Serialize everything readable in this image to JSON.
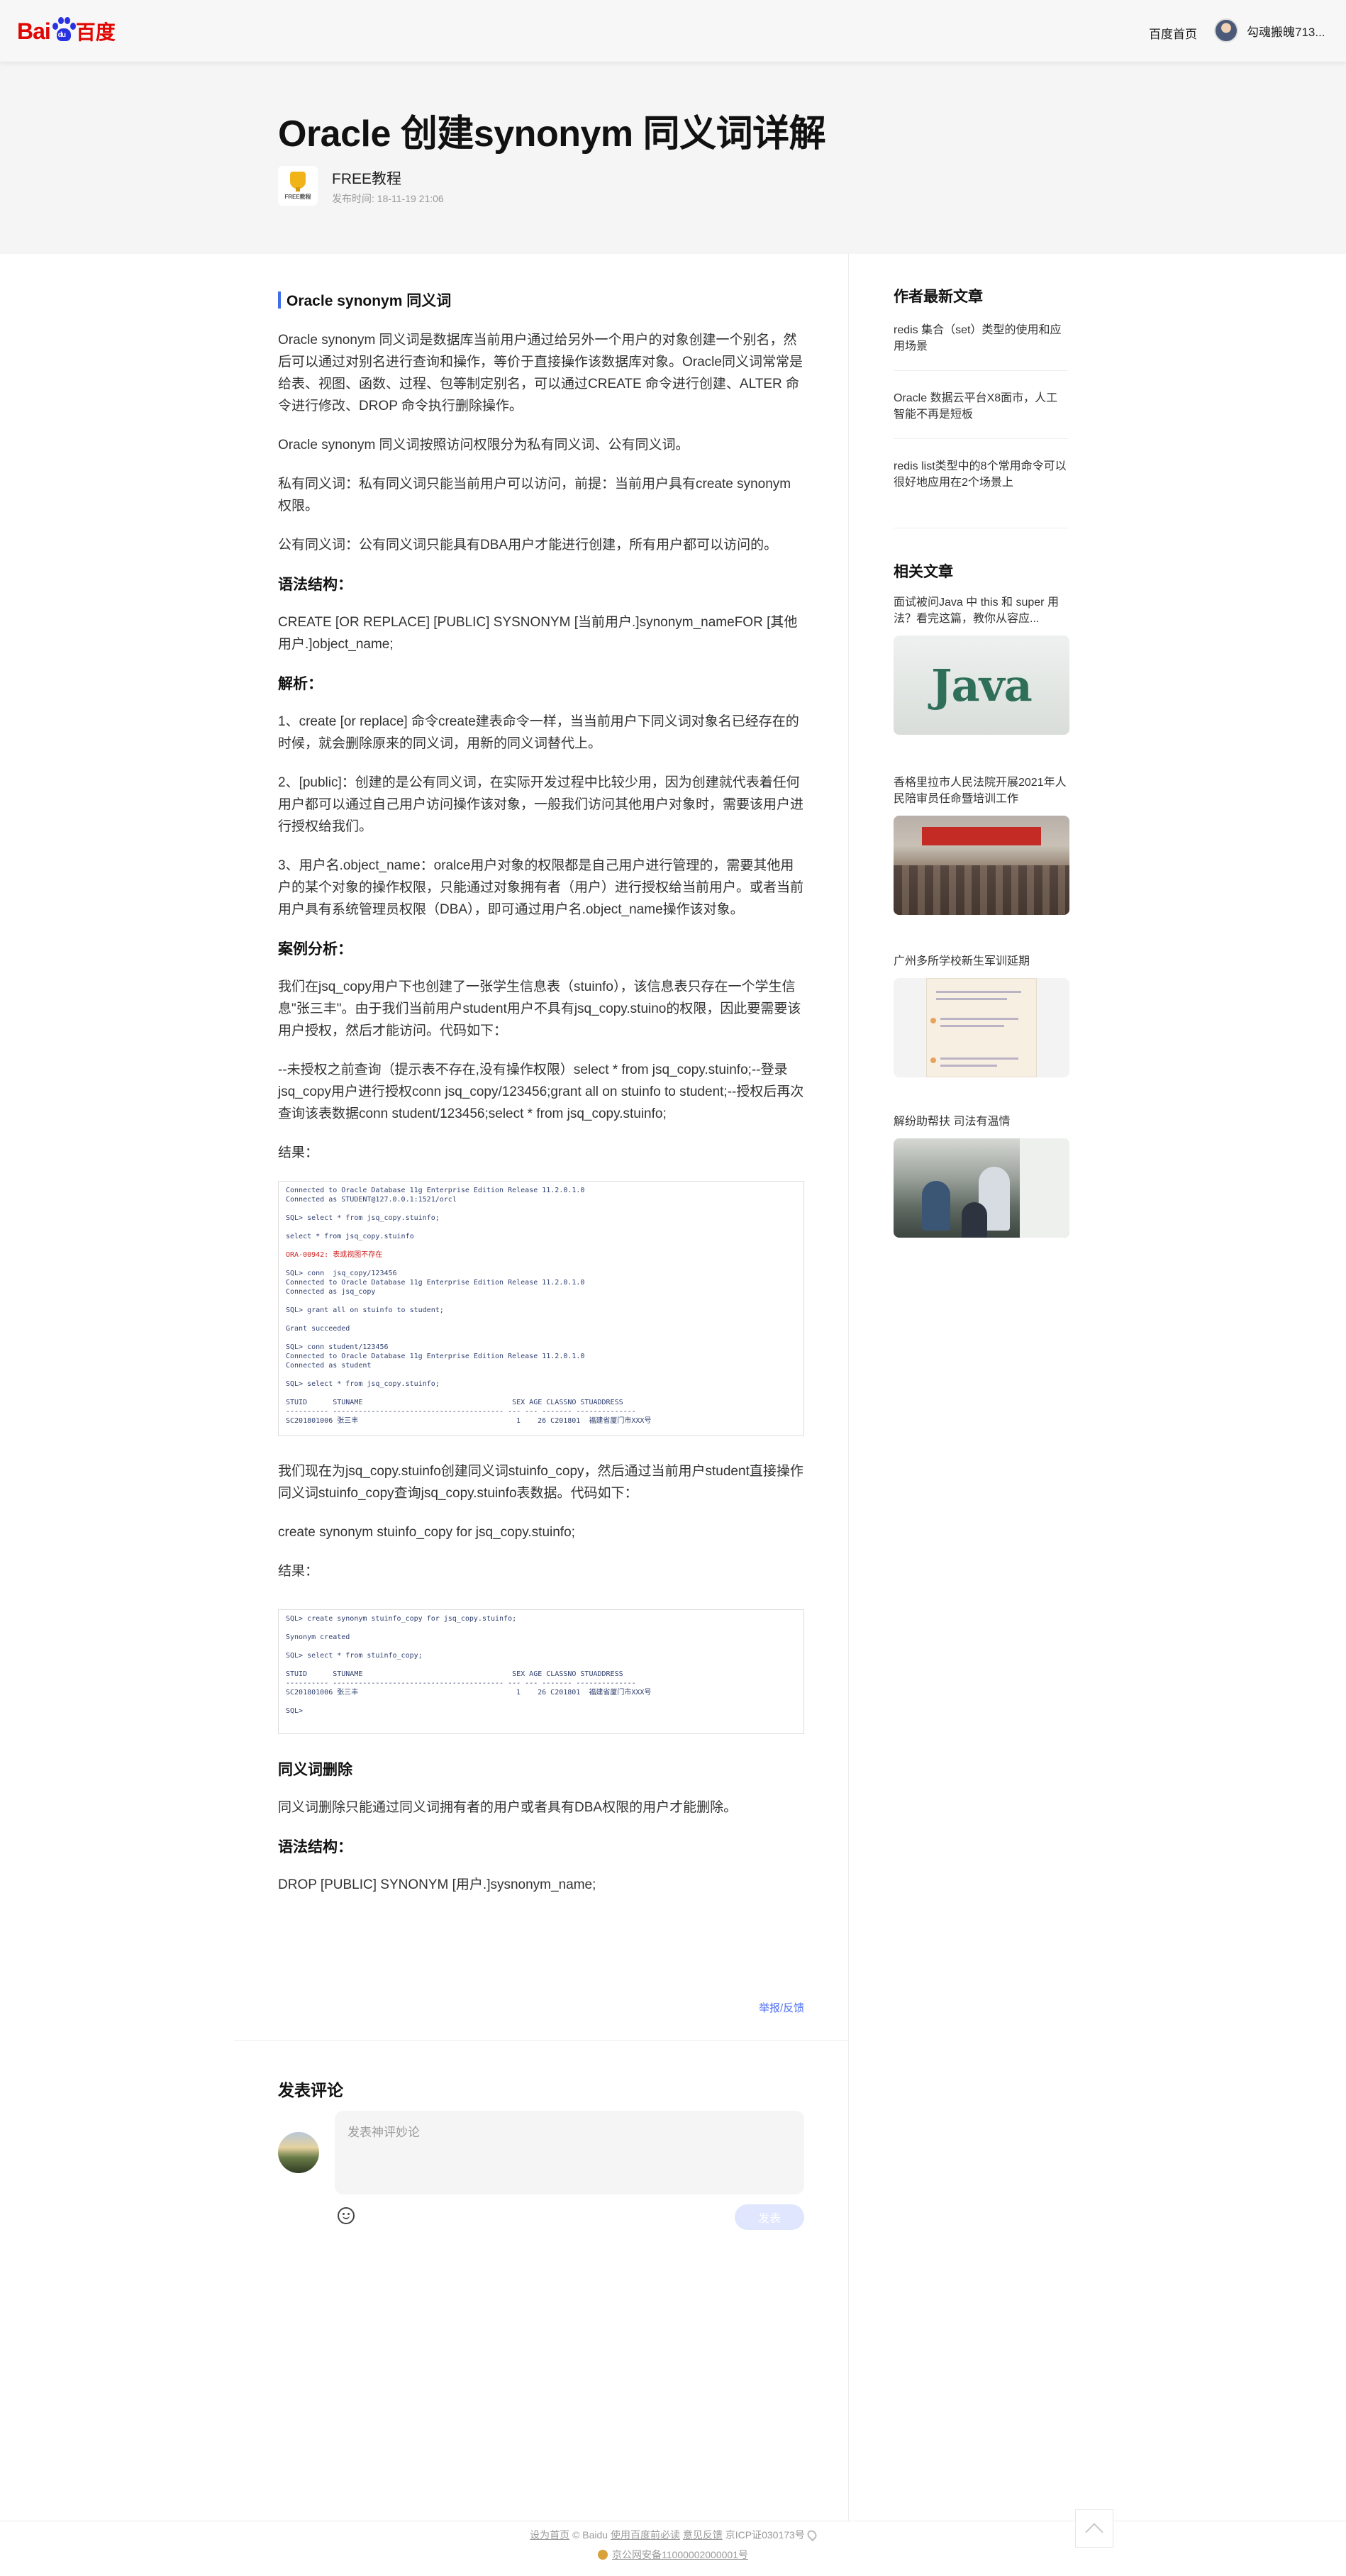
{
  "header": {
    "logo_bai": "Bai",
    "logo_du": "du",
    "logo_cn": "百度",
    "nav_home": "百度首页",
    "user_name": "勾魂搬魄713..."
  },
  "article": {
    "title": "Oracle 创建synonym 同义词详解",
    "author": "FREE教程",
    "author_logo_text": "FREE教程",
    "pub_time": "发布时间: 18-11-19  21:06",
    "section_title": "Oracle synonym 同义词",
    "p1": "Oracle synonym 同义词是数据库当前用户通过给另外一个用户的对象创建一个别名，然后可以通过对别名进行查询和操作，等价于直接操作该数据库对象。Oracle同义词常常是给表、视图、函数、过程、包等制定别名，可以通过CREATE 命令进行创建、ALTER 命令进行修改、DROP 命令执行删除操作。",
    "p2": "Oracle synonym 同义词按照访问权限分为私有同义词、公有同义词。",
    "p3": "私有同义词：私有同义词只能当前用户可以访问，前提：当前用户具有create synonym 权限。",
    "p4": "公有同义词：公有同义词只能具有DBA用户才能进行创建，所有用户都可以访问的。",
    "h_syntax": "语法结构：",
    "p5": "CREATE [OR REPLACE] [PUBLIC] SYSNONYM [当前用户.]synonym_nameFOR [其他用户.]object_name;",
    "h_analysis": "解析：",
    "p6": "1、create [or replace] 命令create建表命令一样，当当前用户下同义词对象名已经存在的时候，就会删除原来的同义词，用新的同义词替代上。",
    "p7": "2、[public]：创建的是公有同义词，在实际开发过程中比较少用，因为创建就代表着任何用户都可以通过自己用户访问操作该对象，一般我们访问其他用户对象时，需要该用户进行授权给我们。",
    "p8": "3、用户名.object_name：oralce用户对象的权限都是自己用户进行管理的，需要其他用户的某个对象的操作权限，只能通过对象拥有者（用户）进行授权给当前用户。或者当前用户具有系统管理员权限（DBA），即可通过用户名.object_name操作该对象。",
    "h_case": "案例分析：",
    "p9": "我们在jsq_copy用户下也创建了一张学生信息表（stuinfo），该信息表只存在一个学生信息\"张三丰\"。由于我们当前用户student用户不具有jsq_copy.stuino的权限，因此要需要该用户授权，然后才能访问。代码如下：",
    "p10": "--未授权之前查询（提示表不存在,没有操作权限）select * from jsq_copy.stuinfo;--登录jsq_copy用户进行授权conn jsq_copy/123456;grant all on stuinfo to student;--授权后再次查询该表数据conn student/123456;select * from jsq_copy.stuinfo;",
    "result1": "结果：",
    "p11": "我们现在为jsq_copy.stuinfo创建同义词stuinfo_copy，然后通过当前用户student直接操作同义词stuinfo_copy查询jsq_copy.stuinfo表数据。代码如下：",
    "p12": "create synonym stuinfo_copy for jsq_copy.stuinfo;",
    "result2": "结果：",
    "h_delete": "同义词删除",
    "p13": "同义词删除只能通过同义词拥有者的用户或者具有DBA权限的用户才能删除。",
    "h_syntax2": "语法结构：",
    "p14": "DROP [PUBLIC] SYNONYM [用户.]sysnonym_name;",
    "report": "举报/反馈"
  },
  "shot1": {
    "lines": [
      "Connected to Oracle Database 11g Enterprise Edition Release 11.2.0.1.0",
      "Connected as STUDENT@127.0.0.1:1521/orcl",
      "",
      "SQL> select * from jsq_copy.stuinfo;",
      "",
      "select * from jsq_copy.stuinfo",
      "",
      "ORA-00942: 表或视图不存在",
      "",
      "SQL> conn  jsq_copy/123456",
      "Connected to Oracle Database 11g Enterprise Edition Release 11.2.0.1.0",
      "Connected as jsq_copy",
      "",
      "SQL> grant all on stuinfo to student;",
      "",
      "Grant succeeded",
      "",
      "SQL> conn student/123456",
      "Connected to Oracle Database 11g Enterprise Edition Release 11.2.0.1.0",
      "Connected as student",
      "",
      "SQL> select * from jsq_copy.stuinfo;",
      "",
      "STUID      STUNAME                                   SEX AGE CLASSNO STUADDRESS",
      "---------- ---------------------------------------- --- --- ------- --------------",
      "SC201801006 张三丰                                     1    26 C201801  福建省厦门市XXX号",
      "",
      "SQL> "
    ]
  },
  "shot2": {
    "lines": [
      "SQL> create synonym stuinfo_copy for jsq_copy.stuinfo;",
      "",
      "Synonym created",
      "",
      "SQL> select * from stuinfo_copy;",
      "",
      "STUID      STUNAME                                   SEX AGE CLASSNO STUADDRESS",
      "---------- ---------------------------------------- --- --- ------- --------------",
      "SC201801006 张三丰                                     1    26 C201801  福建省厦门市XXX号",
      "",
      "SQL> "
    ]
  },
  "comments": {
    "title": "发表评论",
    "placeholder": "发表神评妙论",
    "send": "发表"
  },
  "sidebar": {
    "latest_title": "作者最新文章",
    "latest": [
      "redis 集合（set）类型的使用和应用场景",
      "Oracle 数据云平台X8面市，人工智能不再是短板",
      "redis list类型中的8个常用命令可以很好地应用在2个场景上"
    ],
    "related_title": "相关文章",
    "related": [
      {
        "title": "面试被问Java 中 this 和 super 用法？看完这篇，教你从容应...",
        "thumb_text": "Java"
      },
      {
        "title": "香格里拉市人民法院开展2021年人民陪审员任命暨培训工作"
      },
      {
        "title": "广州多所学校新生军训延期"
      },
      {
        "title": "解纷助帮扶 司法有温情"
      }
    ]
  },
  "footer": {
    "set_home": "设为首页",
    "copyright": "© Baidu",
    "agreement": "使用百度前必读",
    "feedback": "意见反馈",
    "icp": "京ICP证030173号",
    "police": "京公网安备11000002000001号"
  }
}
